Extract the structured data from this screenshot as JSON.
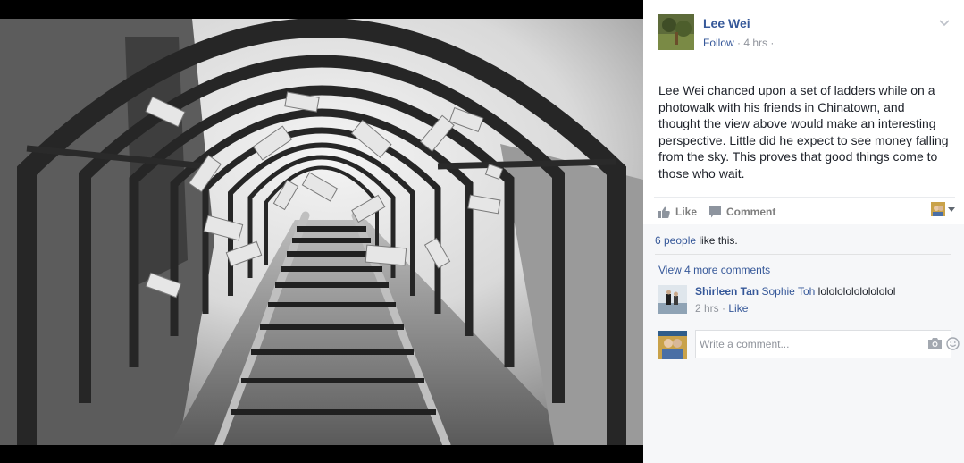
{
  "post": {
    "author": "Lee Wei",
    "follow_label": "Follow",
    "separator": " · ",
    "time": "4 hrs",
    "time_suffix": " ·",
    "menu_glyph": "⌵",
    "caption": "Lee Wei chanced upon a set of ladders while on a photowalk with his friends in Chinatown, and thought the view above would make an interesting perspective. Little did he expect to see money falling from the sky. This proves that good things come to those who wait."
  },
  "actions": {
    "like_label": "Like",
    "comment_label": "Comment"
  },
  "feedback": {
    "likes_count": "6 people",
    "likes_suffix": " like this.",
    "view_more": "View 4 more comments",
    "comments": [
      {
        "author": "Shirleen Tan",
        "tag": "Sophie Toh",
        "text": " lololololololololol",
        "time": "2 hrs",
        "separator": " · ",
        "like_label": "Like"
      }
    ],
    "composer_placeholder": "Write a comment..."
  },
  "icons": {
    "like": "thumbs-up-icon",
    "comment": "speech-bubble-icon",
    "camera": "camera-icon",
    "emoji": "smiley-icon",
    "menu": "chevron-down-icon"
  },
  "colors": {
    "link": "#365899",
    "meta": "#90949c",
    "text": "#1d2129",
    "feedback_bg": "#f6f7f9"
  }
}
